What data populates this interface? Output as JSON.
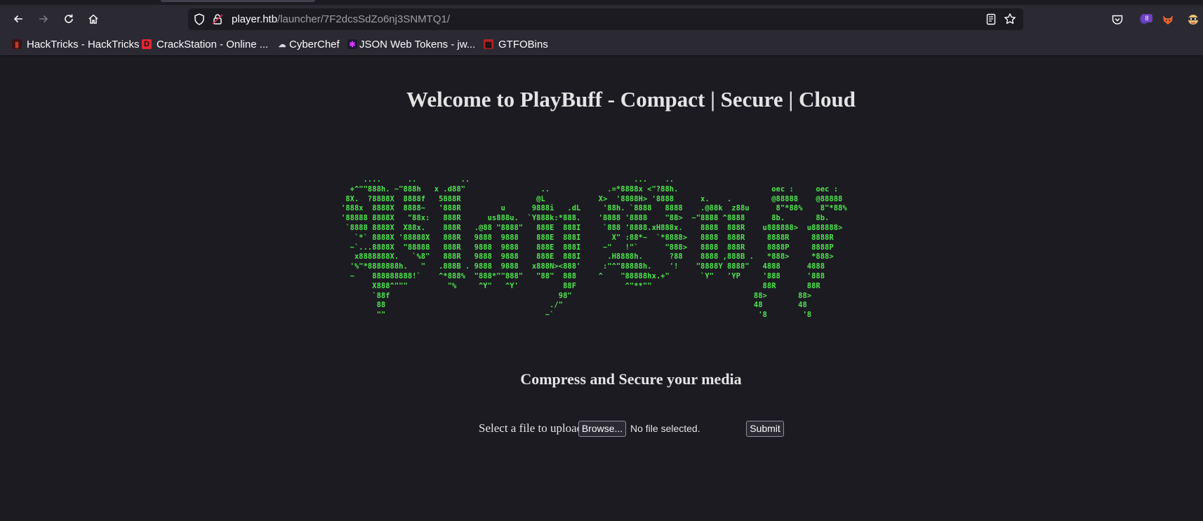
{
  "browser": {
    "url_host": "player.htb",
    "url_path": "/launcher/7F2dcsSdZo6nj3SNMTQ1/",
    "extension_badge": "8"
  },
  "bookmarks": [
    {
      "label": "HackTricks - HackTricks",
      "icon": "hacktricks-icon",
      "color": "#c0392b"
    },
    {
      "label": "CrackStation - Online ...",
      "icon": "crackstation-icon",
      "color": "#e32636"
    },
    {
      "label": "CyberChef",
      "icon": "cyberchef-icon",
      "color": "#cccccc"
    },
    {
      "label": "JSON Web Tokens - jw...",
      "icon": "jwt-icon",
      "color": "#d63aff"
    },
    {
      "label": "GTFOBins",
      "icon": "gtfobins-icon",
      "color": "#b22222"
    }
  ],
  "page": {
    "title": "Welcome to PlayBuff - Compact | Secure | Cloud",
    "ascii_art": "     ....      ..          ..                                     ...    ..\n  +^\"\"888h. ~\"888h   x .d88\"                 ..             .=*8888x <\"?88h.                     oec :     oec :\n 8X.  ?8888X  8888f   5888R                 @L            X>  '8888H> '8888      x.    .         @88888    @88888\n'888x  8888X  8888~   '888R         u      9888i   .dL     '88h. `8888   8888    .@88k  z88u      8\"*88%    8\"*88%\n'88888 8888X   \"88x:   888R      us888u.  `Y888k:*888.    '8888 '8888    \"88>  ~\"8888 ^8888      8b.       8b.\n `8888 8888X  X88x.    888R   .@88 \"8888\"   888E  888I     `888 '8888.xH888x.    8888  888R    u888888>  u888888>\n   `*` 8888X '88888X   888R   9888  9888    888E  888I       X\" :88*~  `*8888>   8888  888R     8888R     8888R\n  ~`...8888X  \"88888   888R   9888  9888    888E  888I     ~\"   !\"`      \"888>   8888  888R     8888P     8888P\n   x8888888X.   `%8\"   888R   9888  9888    888E  888I      .H8888h.      ?88    8888 ,888B .   *888>     *888>\n  '%\"*8888888h.   \"   .888B . 9888  9888   x888N><888'     :\"^\"88888h.    '!    \"8888Y 8888\"   4888      4888\n  ~    888888888!`    ^*888%  \"888*\"\"888\"   \"88\"  888     ^    \"88888hx.+\"       `Y\"   'YP     '888      '888\n       X888^\"\"\"         \"%     ^Y\"   ^Y'          88F           ^\"**\"\"                         88R       88R\n       `88f                                      98\"                                         88>       88>\n        88                                     ./\"                                           48        48\n        \"\"                                    ~`                                              '8        '8",
    "subtitle": "Compress and Secure your media",
    "upload_label": "Select a file to upload",
    "browse_label": "Browse...",
    "file_status": "No file selected.",
    "submit_label": "Submit"
  }
}
